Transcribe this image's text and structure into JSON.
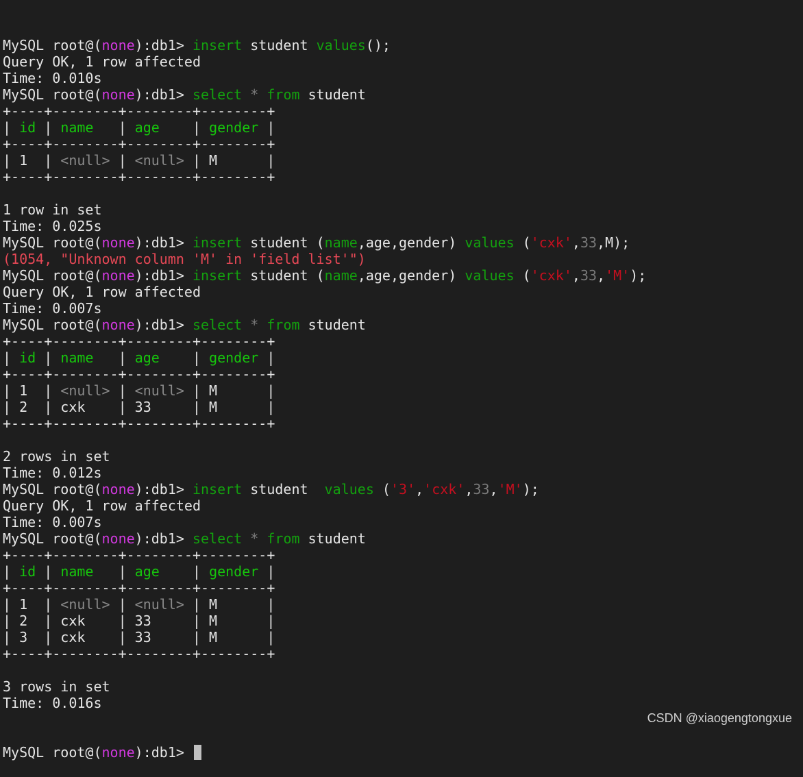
{
  "terminal": {
    "colors": {
      "background": "#1e1e1e",
      "text": "#e6e6e6",
      "keyword": "#13a10e",
      "column_header": "#16c60c",
      "prompt_none": "#d239e0",
      "null_and_number": "#7a7a7a",
      "string": "#c50f1f",
      "error": "#e74856"
    },
    "lines": [
      [
        {
          "t": "MySQL root@(",
          "c": "white"
        },
        {
          "t": "none",
          "c": "pink"
        },
        {
          "t": "):db1> ",
          "c": "white"
        },
        {
          "t": "insert",
          "c": "kw"
        },
        {
          "t": " student ",
          "c": "white"
        },
        {
          "t": "values",
          "c": "kw"
        },
        {
          "t": "();",
          "c": "white"
        }
      ],
      [
        {
          "t": "Query OK, 1 row affected",
          "c": "white"
        }
      ],
      [
        {
          "t": "Time: 0.010s",
          "c": "white"
        }
      ],
      [
        {
          "t": "MySQL root@(",
          "c": "white"
        },
        {
          "t": "none",
          "c": "pink"
        },
        {
          "t": "):db1> ",
          "c": "white"
        },
        {
          "t": "select",
          "c": "kw"
        },
        {
          "t": " ",
          "c": "white"
        },
        {
          "t": "*",
          "c": "gray"
        },
        {
          "t": " ",
          "c": "white"
        },
        {
          "t": "from",
          "c": "kw"
        },
        {
          "t": " student",
          "c": "white"
        }
      ],
      [
        {
          "t": "+----+--------+--------+--------+",
          "c": "border"
        }
      ],
      [
        {
          "t": "| ",
          "c": "border"
        },
        {
          "t": "id",
          "c": "bright"
        },
        {
          "t": " | ",
          "c": "border"
        },
        {
          "t": "name  ",
          "c": "bright"
        },
        {
          "t": " | ",
          "c": "border"
        },
        {
          "t": "age   ",
          "c": "bright"
        },
        {
          "t": " | ",
          "c": "border"
        },
        {
          "t": "gender",
          "c": "bright"
        },
        {
          "t": " |",
          "c": "border"
        }
      ],
      [
        {
          "t": "+----+--------+--------+--------+",
          "c": "border"
        }
      ],
      [
        {
          "t": "| 1  | ",
          "c": "border"
        },
        {
          "t": "<null>",
          "c": "dim"
        },
        {
          "t": " | ",
          "c": "border"
        },
        {
          "t": "<null>",
          "c": "dim"
        },
        {
          "t": " | M      |",
          "c": "border"
        }
      ],
      [
        {
          "t": "+----+--------+--------+--------+",
          "c": "border"
        }
      ],
      [
        {
          "t": "",
          "c": "white"
        }
      ],
      [
        {
          "t": "1 row in set",
          "c": "white"
        }
      ],
      [
        {
          "t": "Time: 0.025s",
          "c": "white"
        }
      ],
      [
        {
          "t": "MySQL root@(",
          "c": "white"
        },
        {
          "t": "none",
          "c": "pink"
        },
        {
          "t": "):db1> ",
          "c": "white"
        },
        {
          "t": "insert",
          "c": "kw"
        },
        {
          "t": " student (",
          "c": "white"
        },
        {
          "t": "name",
          "c": "kw"
        },
        {
          "t": ",age,gender) ",
          "c": "white"
        },
        {
          "t": "values",
          "c": "kw"
        },
        {
          "t": " (",
          "c": "white"
        },
        {
          "t": "'cxk'",
          "c": "str"
        },
        {
          "t": ",",
          "c": "white"
        },
        {
          "t": "33",
          "c": "num"
        },
        {
          "t": ",M);",
          "c": "white"
        }
      ],
      [
        {
          "t": "(1054, \"Unknown column 'M' in 'field list'\")",
          "c": "err"
        }
      ],
      [
        {
          "t": "MySQL root@(",
          "c": "white"
        },
        {
          "t": "none",
          "c": "pink"
        },
        {
          "t": "):db1> ",
          "c": "white"
        },
        {
          "t": "insert",
          "c": "kw"
        },
        {
          "t": " student (",
          "c": "white"
        },
        {
          "t": "name",
          "c": "kw"
        },
        {
          "t": ",age,gender) ",
          "c": "white"
        },
        {
          "t": "values",
          "c": "kw"
        },
        {
          "t": " (",
          "c": "white"
        },
        {
          "t": "'cxk'",
          "c": "str"
        },
        {
          "t": ",",
          "c": "white"
        },
        {
          "t": "33",
          "c": "num"
        },
        {
          "t": ",",
          "c": "white"
        },
        {
          "t": "'M'",
          "c": "str"
        },
        {
          "t": ");",
          "c": "white"
        }
      ],
      [
        {
          "t": "Query OK, 1 row affected",
          "c": "white"
        }
      ],
      [
        {
          "t": "Time: 0.007s",
          "c": "white"
        }
      ],
      [
        {
          "t": "MySQL root@(",
          "c": "white"
        },
        {
          "t": "none",
          "c": "pink"
        },
        {
          "t": "):db1> ",
          "c": "white"
        },
        {
          "t": "select",
          "c": "kw"
        },
        {
          "t": " ",
          "c": "white"
        },
        {
          "t": "*",
          "c": "gray"
        },
        {
          "t": " ",
          "c": "white"
        },
        {
          "t": "from",
          "c": "kw"
        },
        {
          "t": " student",
          "c": "white"
        }
      ],
      [
        {
          "t": "+----+--------+--------+--------+",
          "c": "border"
        }
      ],
      [
        {
          "t": "| ",
          "c": "border"
        },
        {
          "t": "id",
          "c": "bright"
        },
        {
          "t": " | ",
          "c": "border"
        },
        {
          "t": "name  ",
          "c": "bright"
        },
        {
          "t": " | ",
          "c": "border"
        },
        {
          "t": "age   ",
          "c": "bright"
        },
        {
          "t": " | ",
          "c": "border"
        },
        {
          "t": "gender",
          "c": "bright"
        },
        {
          "t": " |",
          "c": "border"
        }
      ],
      [
        {
          "t": "+----+--------+--------+--------+",
          "c": "border"
        }
      ],
      [
        {
          "t": "| 1  | ",
          "c": "border"
        },
        {
          "t": "<null>",
          "c": "dim"
        },
        {
          "t": " | ",
          "c": "border"
        },
        {
          "t": "<null>",
          "c": "dim"
        },
        {
          "t": " | M      |",
          "c": "border"
        }
      ],
      [
        {
          "t": "| 2  | cxk    | 33     | M      |",
          "c": "border"
        }
      ],
      [
        {
          "t": "+----+--------+--------+--------+",
          "c": "border"
        }
      ],
      [
        {
          "t": "",
          "c": "white"
        }
      ],
      [
        {
          "t": "2 rows in set",
          "c": "white"
        }
      ],
      [
        {
          "t": "Time: 0.012s",
          "c": "white"
        }
      ],
      [
        {
          "t": "MySQL root@(",
          "c": "white"
        },
        {
          "t": "none",
          "c": "pink"
        },
        {
          "t": "):db1> ",
          "c": "white"
        },
        {
          "t": "insert",
          "c": "kw"
        },
        {
          "t": " student  ",
          "c": "white"
        },
        {
          "t": "values",
          "c": "kw"
        },
        {
          "t": " (",
          "c": "white"
        },
        {
          "t": "'3'",
          "c": "str"
        },
        {
          "t": ",",
          "c": "white"
        },
        {
          "t": "'cxk'",
          "c": "str"
        },
        {
          "t": ",",
          "c": "white"
        },
        {
          "t": "33",
          "c": "num"
        },
        {
          "t": ",",
          "c": "white"
        },
        {
          "t": "'M'",
          "c": "str"
        },
        {
          "t": ");",
          "c": "white"
        }
      ],
      [
        {
          "t": "Query OK, 1 row affected",
          "c": "white"
        }
      ],
      [
        {
          "t": "Time: 0.007s",
          "c": "white"
        }
      ],
      [
        {
          "t": "MySQL root@(",
          "c": "white"
        },
        {
          "t": "none",
          "c": "pink"
        },
        {
          "t": "):db1> ",
          "c": "white"
        },
        {
          "t": "select",
          "c": "kw"
        },
        {
          "t": " ",
          "c": "white"
        },
        {
          "t": "*",
          "c": "gray"
        },
        {
          "t": " ",
          "c": "white"
        },
        {
          "t": "from",
          "c": "kw"
        },
        {
          "t": " student",
          "c": "white"
        }
      ],
      [
        {
          "t": "+----+--------+--------+--------+",
          "c": "border"
        }
      ],
      [
        {
          "t": "| ",
          "c": "border"
        },
        {
          "t": "id",
          "c": "bright"
        },
        {
          "t": " | ",
          "c": "border"
        },
        {
          "t": "name  ",
          "c": "bright"
        },
        {
          "t": " | ",
          "c": "border"
        },
        {
          "t": "age   ",
          "c": "bright"
        },
        {
          "t": " | ",
          "c": "border"
        },
        {
          "t": "gender",
          "c": "bright"
        },
        {
          "t": " |",
          "c": "border"
        }
      ],
      [
        {
          "t": "+----+--------+--------+--------+",
          "c": "border"
        }
      ],
      [
        {
          "t": "| 1  | ",
          "c": "border"
        },
        {
          "t": "<null>",
          "c": "dim"
        },
        {
          "t": " | ",
          "c": "border"
        },
        {
          "t": "<null>",
          "c": "dim"
        },
        {
          "t": " | M      |",
          "c": "border"
        }
      ],
      [
        {
          "t": "| 2  | cxk    | 33     | M      |",
          "c": "border"
        }
      ],
      [
        {
          "t": "| 3  | cxk    | 33     | M      |",
          "c": "border"
        }
      ],
      [
        {
          "t": "+----+--------+--------+--------+",
          "c": "border"
        }
      ],
      [
        {
          "t": "",
          "c": "white"
        }
      ],
      [
        {
          "t": "3 rows in set",
          "c": "white"
        }
      ],
      [
        {
          "t": "Time: 0.016s",
          "c": "white"
        }
      ]
    ],
    "prompt": {
      "prefix": "MySQL root@(",
      "host": "none",
      "suffix": "):db1> "
    }
  },
  "watermark": {
    "text": "CSDN @xiaogengtongxue"
  }
}
